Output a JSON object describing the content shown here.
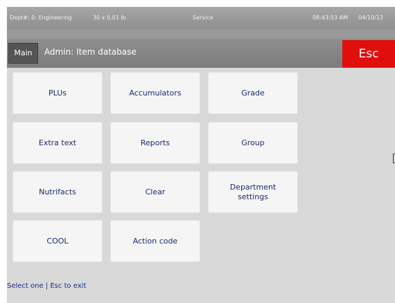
{
  "status": {
    "dept": "Dept#: 0: Engineering",
    "tare": "30 x 0.01 lb",
    "mode": "Service",
    "time": "08:43:53 AM",
    "date": "04/10/12"
  },
  "header": {
    "main_label": "Main",
    "title": "Admin: Item database",
    "esc_label": "Esc"
  },
  "tiles": [
    {
      "label": "PLUs"
    },
    {
      "label": "Accumulators"
    },
    {
      "label": "Grade"
    },
    {
      "label": "Extra text"
    },
    {
      "label": "Reports"
    },
    {
      "label": "Group"
    },
    {
      "label": "Nutrifacts"
    },
    {
      "label": "Clear"
    },
    {
      "label": "Department settings"
    },
    {
      "label": "COOL"
    },
    {
      "label": "Action code"
    }
  ],
  "footer": {
    "hint": "Select one | Esc to exit"
  },
  "colors": {
    "esc": "#e10e0e",
    "tile_text": "#1a2a70",
    "background": "#d8d8d8"
  }
}
